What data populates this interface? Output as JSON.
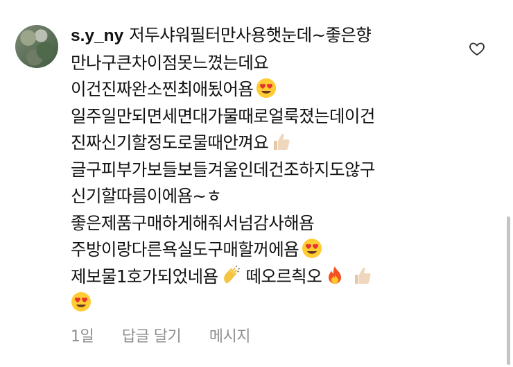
{
  "comment": {
    "username": "s.y_ny",
    "lines": [
      {
        "text": "저두샤워필터만사용햇눈데~좋은향",
        "emoji": null
      },
      {
        "text": "만나구큰차이점못느꼈는데요",
        "emoji": null
      },
      {
        "text": "이건진짜완소찐최애됬어욤",
        "emoji": "heart-eyes-emoji"
      },
      {
        "text": "일주일만되면세면대가물때로얼룩졌는데이건",
        "emoji": null
      },
      {
        "text": "진짜신기할정도로물때안껴요",
        "emoji": "thumbs-up-emoji"
      },
      {
        "text": "글구피부가보들보들겨울인데건조하지도않구",
        "emoji": null
      },
      {
        "text": "신기할따름이에욤~ㅎ",
        "emoji": null
      },
      {
        "text": "좋은제품구매하게해줘서넘감사해욤",
        "emoji": null
      },
      {
        "text": "주방이랑다른욕실도구매할꺼에욤",
        "emoji": "heart-eyes-emoji"
      },
      {
        "text": "제보물1호가되었네욤",
        "emoji": "clapping-hands-emoji",
        "after": "떼오르츽오",
        "after_emojis": [
          "fire-emoji",
          "thumbs-up-emoji"
        ]
      },
      {
        "text": "",
        "emoji": "heart-eyes-emoji"
      }
    ]
  },
  "meta": {
    "time": "1일",
    "reply": "답글 달기",
    "message": "메시지"
  },
  "icons": {
    "like": "heart-outline-icon"
  },
  "colors": {
    "text": "#111111",
    "muted": "#8e8e8e",
    "heart": "#262626"
  }
}
